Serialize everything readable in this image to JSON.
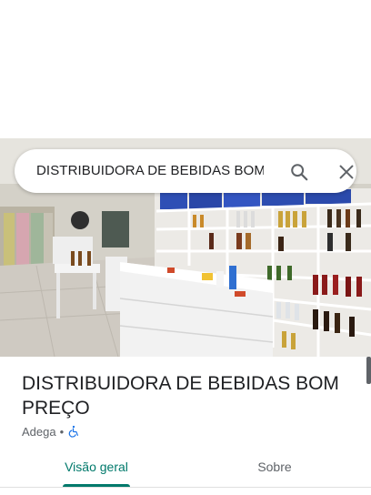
{
  "search": {
    "query": "DISTRIBUIDORA DE BEBIDAS BOM PREÇO"
  },
  "place": {
    "title": "DISTRIBUIDORA DE BEBIDAS BOM PREÇO",
    "category": "Adega",
    "separator": "•",
    "accessibility_icon": "wheelchair-icon"
  },
  "tabs": [
    {
      "label": "Visão geral",
      "selected": true
    },
    {
      "label": "Sobre",
      "selected": false
    }
  ],
  "colors": {
    "accent": "#00796b",
    "title": "#202124",
    "secondary": "#5f6368",
    "accessibility": "#1a73e8"
  },
  "icons": {
    "search": "search-icon",
    "close": "close-icon"
  }
}
